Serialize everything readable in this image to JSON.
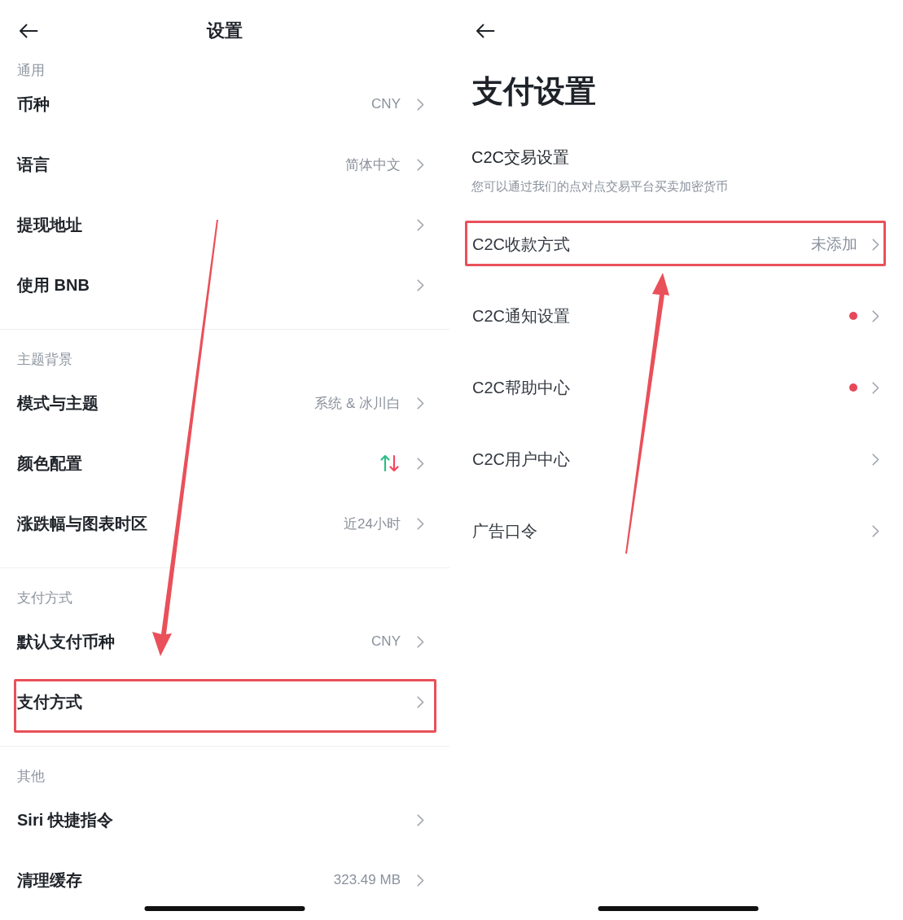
{
  "settings": {
    "title": "设置",
    "annotation_arrow": true,
    "sections": [
      {
        "title": "通用",
        "items": [
          {
            "kind": "value",
            "label": "币种",
            "value": "CNY",
            "highlighted": false
          },
          {
            "kind": "value",
            "label": "语言",
            "value": "简体中文",
            "highlighted": false
          },
          {
            "kind": "link",
            "label": "提现地址",
            "highlighted": false
          },
          {
            "kind": "link",
            "label": "使用 BNB",
            "highlighted": false
          }
        ]
      },
      {
        "title": "主题背景",
        "items": [
          {
            "kind": "value",
            "label": "模式与主题",
            "value": "系统 & 冰川白",
            "highlighted": false
          },
          {
            "kind": "color-scheme",
            "label": "颜色配置",
            "highlighted": false
          },
          {
            "kind": "value",
            "label": "涨跌幅与图表时区",
            "value": "近24小时",
            "highlighted": false
          }
        ]
      },
      {
        "title": "支付方式",
        "items": [
          {
            "kind": "value",
            "label": "默认支付币种",
            "value": "CNY",
            "highlighted": false
          },
          {
            "kind": "link",
            "label": "支付方式",
            "highlighted": true
          }
        ]
      },
      {
        "title": "其他",
        "items": [
          {
            "kind": "link",
            "label": "Siri 快捷指令",
            "highlighted": false
          },
          {
            "kind": "value",
            "label": "清理缓存",
            "value": "323.49 MB",
            "highlighted": false
          }
        ]
      }
    ]
  },
  "payment_settings": {
    "title": "支付设置",
    "annotation_arrow": true,
    "c2c_trading": {
      "title": "C2C交易设置",
      "description": "您可以通过我们的点对点交易平台买卖加密货币"
    },
    "items": [
      {
        "label": "C2C收款方式",
        "value": "未添加",
        "notification_dot": false,
        "highlighted": true
      },
      {
        "label": "C2C通知设置",
        "notification_dot": true,
        "highlighted": false
      },
      {
        "label": "C2C帮助中心",
        "notification_dot": true,
        "highlighted": false
      },
      {
        "label": "C2C用户中心",
        "notification_dot": false,
        "highlighted": false
      },
      {
        "label": "广告口令",
        "notification_dot": false,
        "highlighted": false
      }
    ]
  }
}
